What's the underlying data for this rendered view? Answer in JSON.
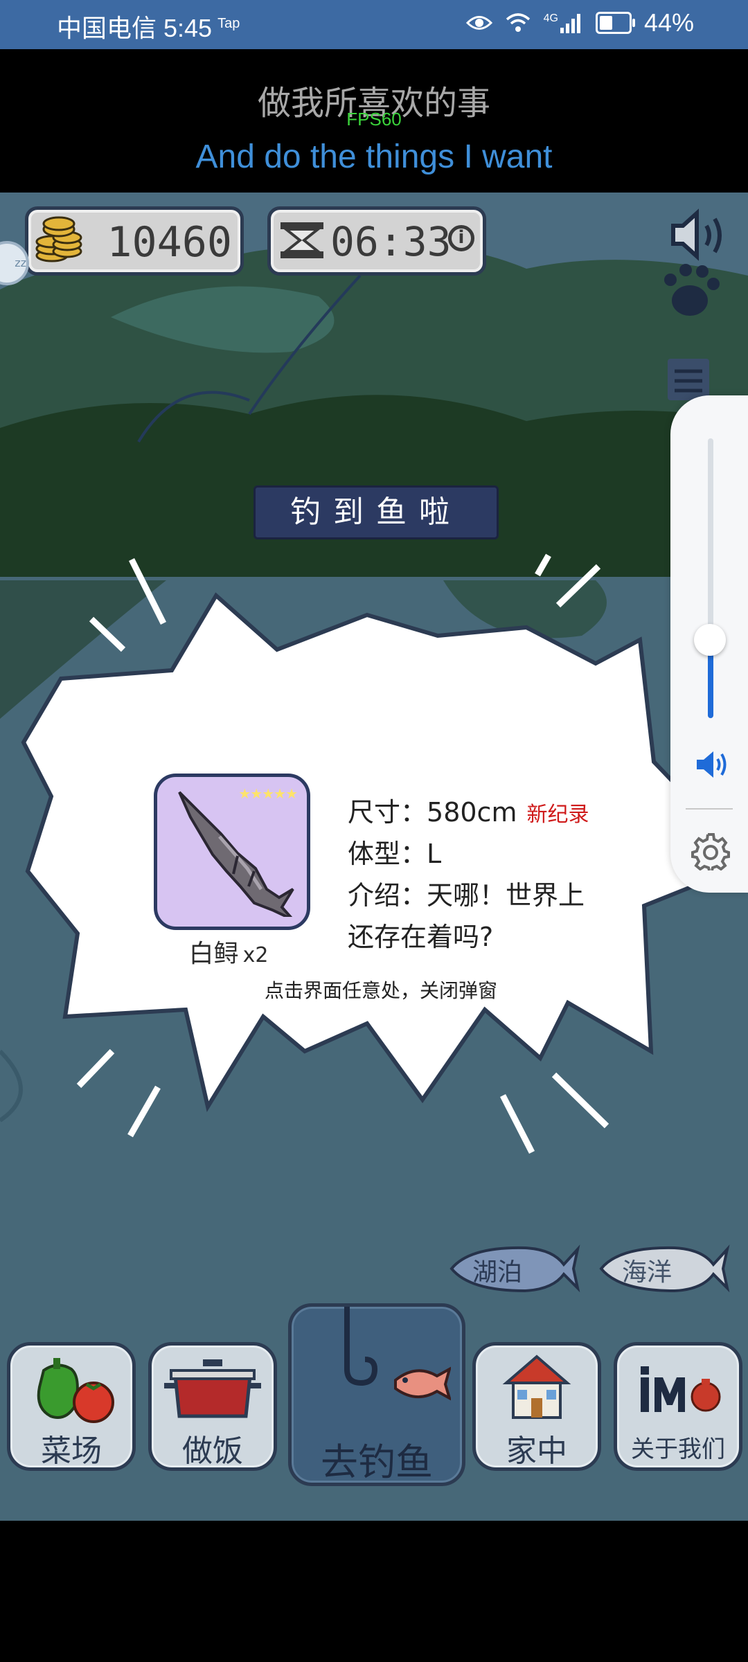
{
  "status_bar": {
    "carrier_time": "中国电信 5:45",
    "tap_badge": "Tap",
    "network": "4G",
    "battery": "44%"
  },
  "lyrics": {
    "cn": "做我所喜欢的事",
    "fps": "FPS60",
    "en": "And do the things I want"
  },
  "hud": {
    "coins": "10460",
    "timer": "06:33",
    "info_symbol": "i",
    "float_label": "zz"
  },
  "popup": {
    "title": "钓到鱼啦",
    "stars": "★★★★★",
    "fish_name": "白鲟",
    "fish_count": "x2",
    "size_label": "尺寸：",
    "size_value": "580cm",
    "record_badge": "新纪录",
    "type_label": "体型：",
    "type_value": "L",
    "intro_label": "介绍：",
    "intro_line1": "天哪！世界上",
    "intro_line2": "还存在着吗?",
    "close_hint": "点击界面任意处，关闭弹窗"
  },
  "volume": {
    "level": 0.28
  },
  "water_tags": {
    "lake": "湖泊",
    "ocean": "海洋"
  },
  "nav": {
    "farm": "菜场",
    "cook": "做饭",
    "fish": "去钓鱼",
    "home": "家中",
    "about": "关于我们"
  },
  "colors": {
    "status_bar": "#3d6aa3",
    "lyric_en": "#3f8fd9",
    "fps": "#3bd33b",
    "record": "#cf1a1a",
    "popup_title_bg": "#2c3a62",
    "volume_accent": "#1f6bd8"
  }
}
